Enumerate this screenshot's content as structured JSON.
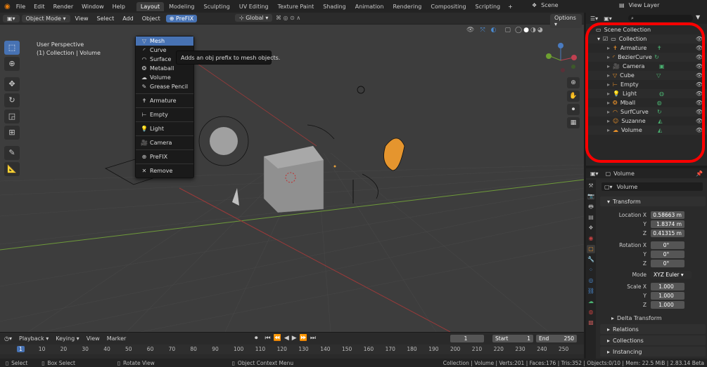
{
  "menu": [
    "File",
    "Edit",
    "Render",
    "Window",
    "Help"
  ],
  "workspaces": [
    "Layout",
    "Modeling",
    "Sculpting",
    "UV Editing",
    "Texture Paint",
    "Shading",
    "Animation",
    "Rendering",
    "Compositing",
    "Scripting"
  ],
  "scene": "Scene",
  "view_layer": "View Layer",
  "viewport": {
    "mode": "Object Mode",
    "header_menus": [
      "View",
      "Select",
      "Add",
      "Object"
    ],
    "prefix_menu": "PreFIX",
    "orientation": "Global",
    "options": "Options",
    "perspective": "User Perspective",
    "collection_info": "(1) Collection | Volume"
  },
  "dropdown": {
    "items": [
      {
        "label": "Mesh",
        "icon": "mesh-icon"
      },
      {
        "label": "Curve",
        "icon": "curve-icon"
      },
      {
        "label": "Surface",
        "icon": "surface-icon"
      },
      {
        "label": "Metaball",
        "icon": "metaball-icon"
      },
      {
        "label": "Volume",
        "icon": "volume-icon"
      },
      {
        "label": "Grease Pencil",
        "icon": "grease-pencil-icon"
      },
      {
        "label": "Armature",
        "icon": "armature-icon"
      },
      {
        "label": "Empty",
        "icon": "empty-icon"
      },
      {
        "label": "Light",
        "icon": "light-icon"
      },
      {
        "label": "Camera",
        "icon": "camera-icon"
      },
      {
        "label": "PreFIX",
        "icon": "plus-icon"
      },
      {
        "label": "Remove",
        "icon": "x-icon"
      }
    ],
    "tooltip": "Adds an obj prefix to mesh objects."
  },
  "timeline": {
    "menus": [
      "Playback",
      "Keying",
      "View",
      "Marker"
    ],
    "current_frame": "1",
    "start_label": "Start",
    "start": "1",
    "end_label": "End",
    "end": "250",
    "ruler": [
      "1",
      "10",
      "20",
      "30",
      "40",
      "50",
      "60",
      "70",
      "80",
      "90",
      "100",
      "110",
      "120",
      "130",
      "140",
      "150",
      "160",
      "170",
      "180",
      "190",
      "200",
      "210",
      "220",
      "230",
      "240",
      "250"
    ]
  },
  "status": {
    "select": "Select",
    "box_select": "Box Select",
    "rotate_view": "Rotate View",
    "context_menu": "Object Context Menu",
    "stats": "Collection | Volume | Verts:201 | Faces:176 | Tris:352 | Objects:0/10 | Mem: 22.5 MiB | 2.83.14 Beta"
  },
  "outliner": {
    "root": "Scene Collection",
    "collection": "Collection",
    "items": [
      "Armature",
      "BezierCurve",
      "Camera",
      "Cube",
      "Empty",
      "Light",
      "Mball",
      "SurfCurve",
      "Suzanne",
      "Volume"
    ]
  },
  "properties": {
    "object_name": "Volume",
    "data_name": "Volume",
    "transform_label": "Transform",
    "location_label": "Location X",
    "location": [
      "0.58663 m",
      "1.8374 m",
      "0.41315 m"
    ],
    "rotation_label": "Rotation X",
    "rotation": [
      "0°",
      "0°",
      "0°"
    ],
    "mode_label": "Mode",
    "mode": "XYZ Euler",
    "scale_label": "Scale X",
    "scale": [
      "1.000",
      "1.000",
      "1.000"
    ],
    "axis_y": "Y",
    "axis_z": "Z",
    "delta_transform": "Delta Transform",
    "relations": "Relations",
    "collections": "Collections",
    "instancing": "Instancing"
  },
  "colors": {
    "accent": "#4772b3",
    "highlight_ring": "#ff0000"
  }
}
